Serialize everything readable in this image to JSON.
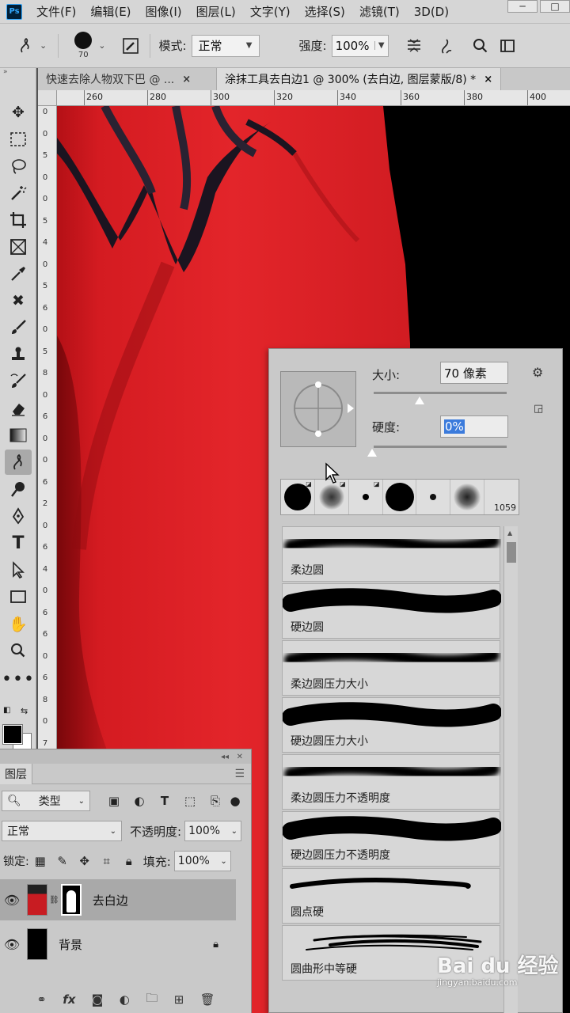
{
  "app": {
    "logo": "Ps"
  },
  "menu": [
    "文件(F)",
    "编辑(E)",
    "图像(I)",
    "图层(L)",
    "文字(Y)",
    "选择(S)",
    "滤镜(T)",
    "3D(D)"
  ],
  "options": {
    "brush_size": "70",
    "mode_label": "模式:",
    "mode_value": "正常",
    "strength_label": "强度:",
    "strength_value": "100%"
  },
  "tabs": [
    {
      "label": "快速去除人物双下巴 @ ...",
      "close": "×"
    },
    {
      "label": "涂抹工具去白边1 @ 300% (去白边, 图层蒙版/8) *",
      "close": "×"
    }
  ],
  "ruler": {
    "h_labels": [
      "260",
      "280",
      "300",
      "320",
      "340",
      "360",
      "380",
      "400"
    ],
    "v_digits": [
      "0",
      "0",
      "5",
      "0",
      "0",
      "5",
      "4",
      "0",
      "5",
      "6",
      "0",
      "5",
      "8",
      "0",
      "6",
      "0",
      "0",
      "6",
      "2",
      "0",
      "6",
      "4",
      "0",
      "6",
      "6",
      "0",
      "6",
      "8",
      "0",
      "7"
    ]
  },
  "brush_panel": {
    "size_label": "大小:",
    "size_value": "70 像素",
    "hardness_label": "硬度:",
    "hardness_value": "0%",
    "tip_count": "1059",
    "presets": [
      {
        "name": "柔边圆",
        "style": "soft"
      },
      {
        "name": "硬边圆",
        "style": "hard"
      },
      {
        "name": "柔边圆压力大小",
        "style": "soft"
      },
      {
        "name": "硬边圆压力大小",
        "style": "hard"
      },
      {
        "name": "柔边圆压力不透明度",
        "style": "soft"
      },
      {
        "name": "硬边圆压力不透明度",
        "style": "hard"
      },
      {
        "name": "圆点硬",
        "style": "thin"
      },
      {
        "name": "圆曲形中等硬",
        "style": "bristle"
      }
    ]
  },
  "layers": {
    "tab": "图层",
    "filter_value": "类型",
    "blend_value": "正常",
    "opacity_label": "不透明度:",
    "opacity_value": "100%",
    "lock_label": "锁定:",
    "fill_label": "填充:",
    "fill_value": "100%",
    "items": [
      {
        "name": "去白边",
        "selected": true
      },
      {
        "name": "背景",
        "selected": false
      }
    ],
    "bottom_icons": [
      "GO",
      "fx",
      "□",
      "◐",
      "▭",
      "⊞",
      "🗑"
    ]
  },
  "watermark": {
    "brand": "Bai du 经验",
    "sub": "jingyan.baidu.com"
  },
  "colors": {
    "accent": "#31a8ff",
    "dress": "#d81c22",
    "canvas_bg": "#000000"
  }
}
